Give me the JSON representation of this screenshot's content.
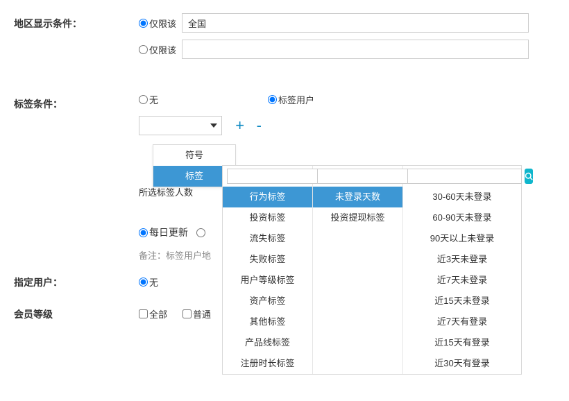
{
  "region": {
    "label": "地区显示条件：",
    "only_this": "仅限该",
    "value": "全国",
    "only_this2": "仅限该"
  },
  "tag": {
    "label": "标签条件：",
    "none": "无",
    "tag_user": "标签用户",
    "plus": "+",
    "minus": "-",
    "dropdown": {
      "symbol": "符号",
      "tag": "标签"
    },
    "col1": [
      "行为标签",
      "投资标签",
      "流失标签",
      "失败标签",
      "用户等级标签",
      "资产标签",
      "其他标签",
      "产品线标签",
      "注册时长标签"
    ],
    "col2": [
      "未登录天数",
      "投资提现标签"
    ],
    "col3": [
      "30-60天未登录",
      "60-90天未登录",
      "90天以上未登录",
      "近3天未登录",
      "近7天未登录",
      "近15天未登录",
      "近7天有登录",
      "近15天有登录",
      "近30天有登录"
    ]
  },
  "selected_count": "所选标签人数",
  "daily_update": "每日更新",
  "note_prefix": "备注：",
  "note_text": "标签用户地",
  "specified_user": {
    "label": "指定用户：",
    "none": "无"
  },
  "member_level": {
    "label": "会员等级",
    "all": "全部",
    "normal": "普通"
  }
}
